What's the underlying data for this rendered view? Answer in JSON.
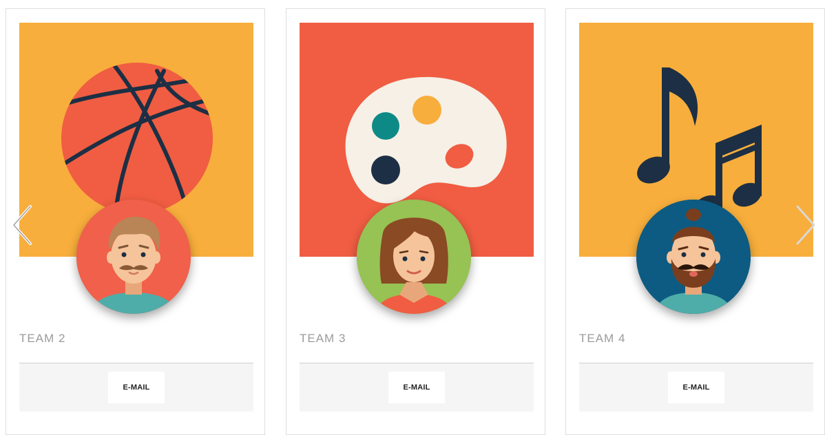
{
  "colors": {
    "yellow": "#F8AE3C",
    "coral": "#F05D42",
    "navy": "#1D2F44",
    "card_border": "#DEDEDE",
    "footer_bg": "#F5F5F5",
    "team_text": "#9B9B9B"
  },
  "carousel": {
    "prev_icon": "chevron-left-icon",
    "next_icon": "chevron-right-icon"
  },
  "cards": [
    {
      "team_name": "TEAM 2",
      "banner_color": "#F8AE3C",
      "banner_icon": "basketball-icon",
      "avatar_icon": "man-mustache-avatar-icon",
      "avatar_bg": "#F0604A",
      "email_label": "E-MAIL"
    },
    {
      "team_name": "TEAM 3",
      "banner_color": "#F05D42",
      "banner_icon": "paint-palette-icon",
      "avatar_icon": "woman-avatar-icon",
      "avatar_bg": "#97C254",
      "email_label": "E-MAIL"
    },
    {
      "team_name": "TEAM 4",
      "banner_color": "#F8AE3C",
      "banner_icon": "music-notes-icon",
      "avatar_icon": "man-beard-avatar-icon",
      "avatar_bg": "#0D5B82",
      "email_label": "E-MAIL"
    }
  ]
}
